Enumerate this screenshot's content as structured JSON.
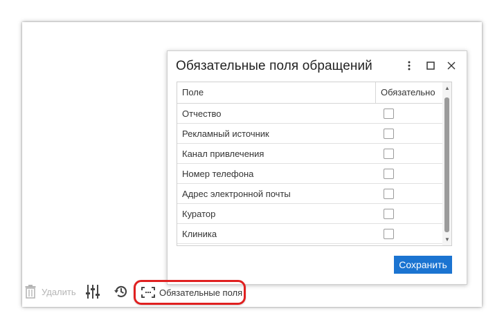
{
  "dialog": {
    "title": "Обязательные поля обращений",
    "icons": {
      "menu": "more-vertical-icon",
      "maximize": "maximize-icon",
      "close": "close-icon"
    },
    "table": {
      "columns": [
        "Поле",
        "Обязательно"
      ],
      "rows": [
        {
          "name": "Отчество",
          "required": false
        },
        {
          "name": "Рекламный источник",
          "required": false
        },
        {
          "name": "Канал привлечения",
          "required": false
        },
        {
          "name": "Номер телефона",
          "required": false
        },
        {
          "name": "Адрес электронной почты",
          "required": false
        },
        {
          "name": "Куратор",
          "required": false
        },
        {
          "name": "Клиника",
          "required": false
        }
      ]
    },
    "save_label": "Сохранить"
  },
  "toolbar": {
    "delete_label": "Удалить",
    "required_fields_label": "Обязательные поля",
    "icons": [
      "trash-icon",
      "sliders-icon",
      "history-icon",
      "required-fields-icon"
    ]
  },
  "colors": {
    "primary": "#1b74d1",
    "highlight": "#e02020",
    "disabled": "#b5b5b5"
  }
}
